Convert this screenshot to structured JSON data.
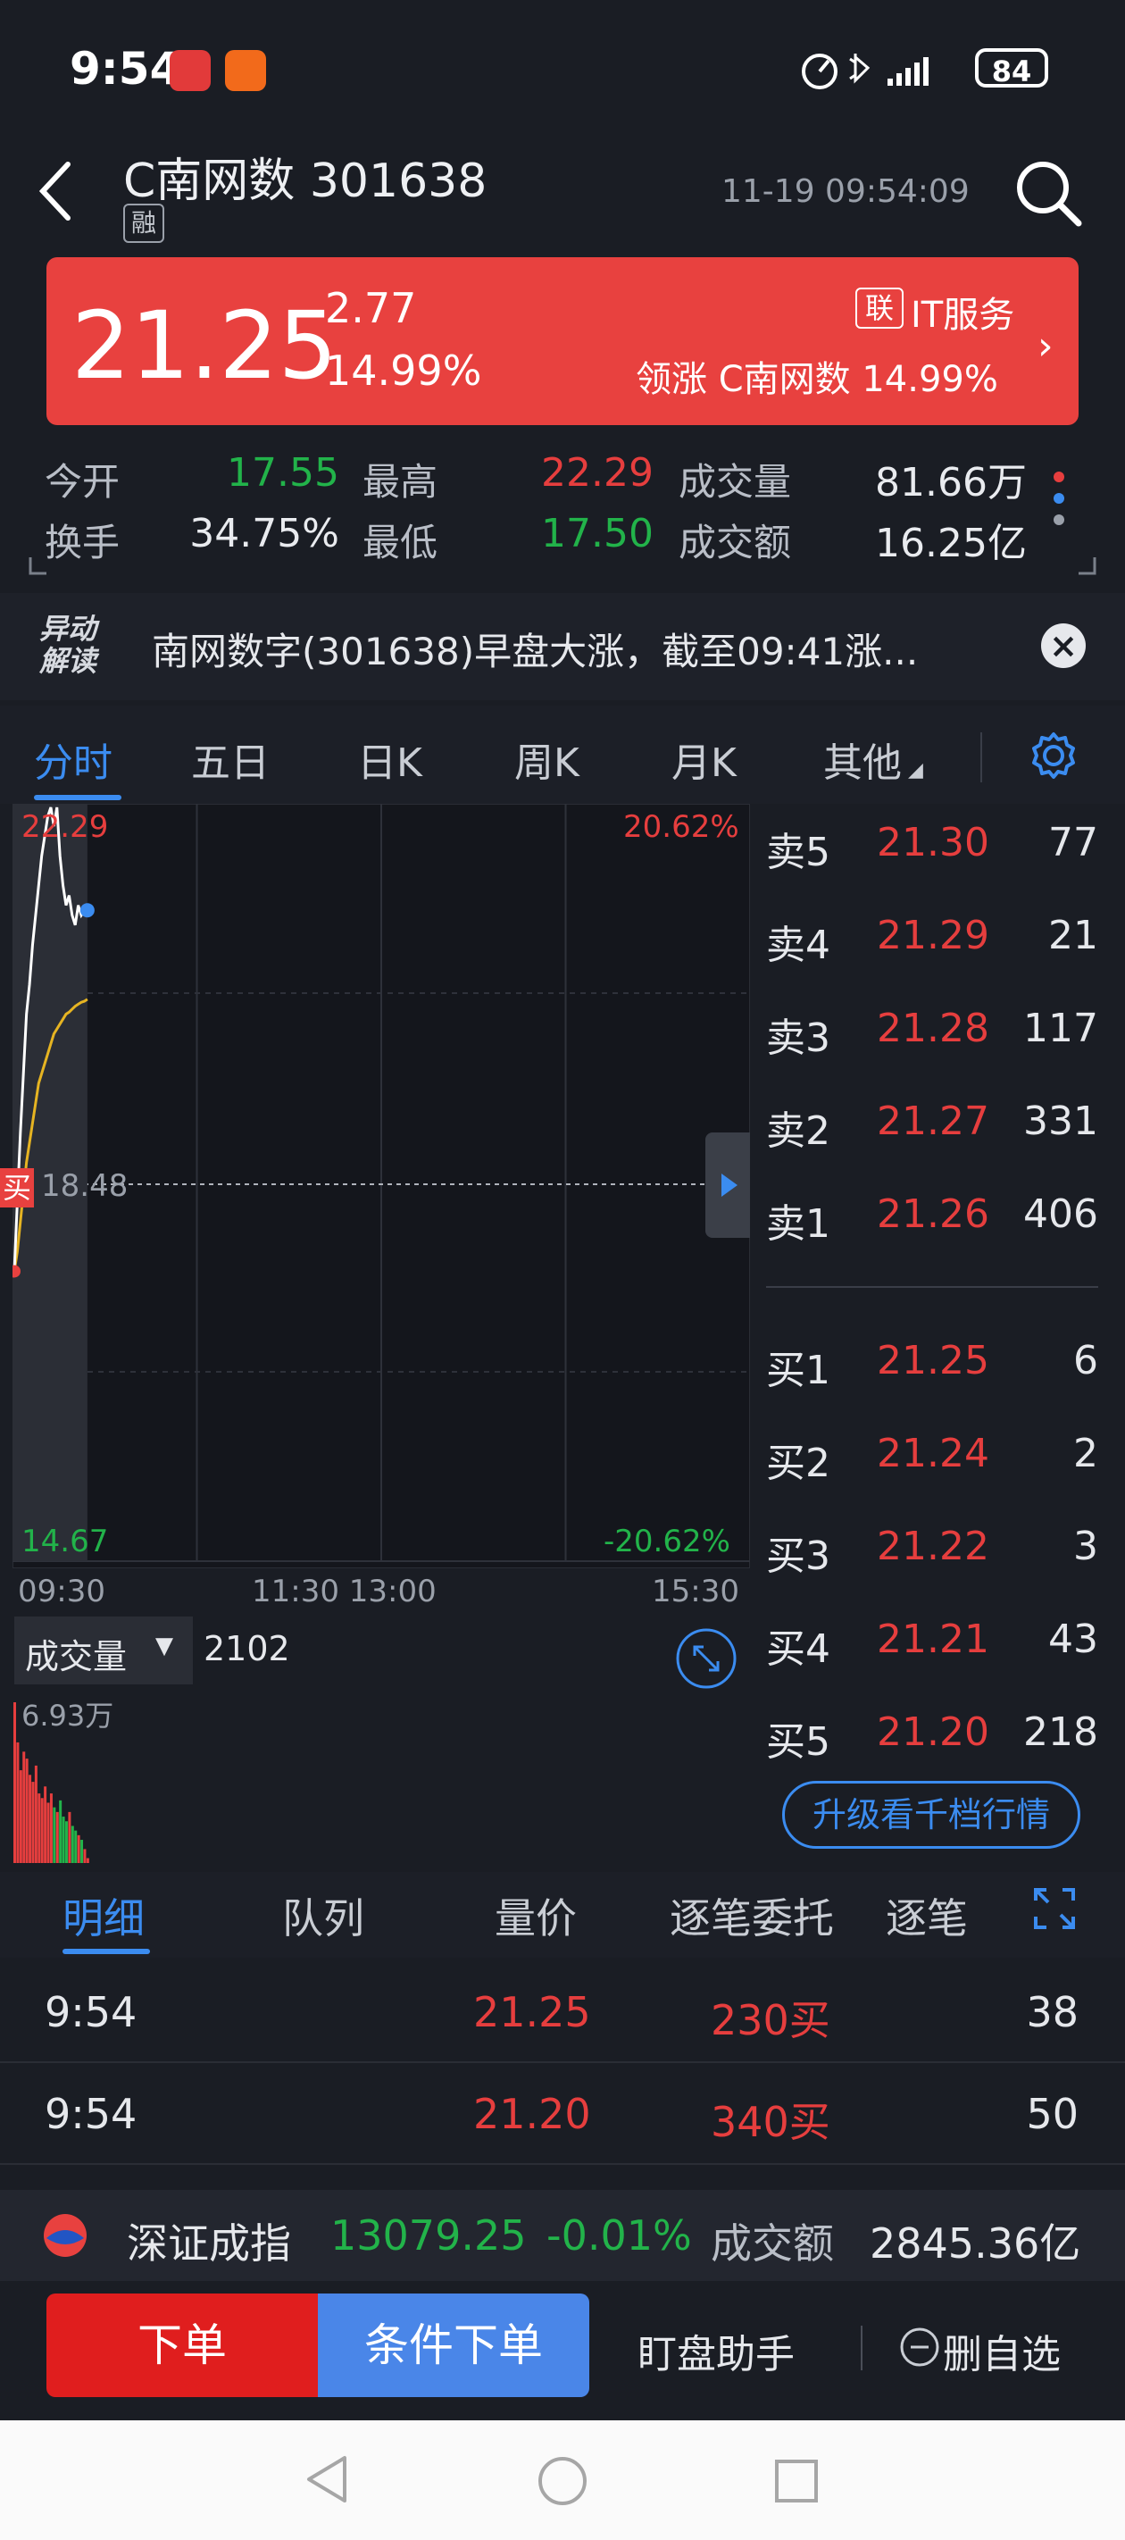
{
  "status": {
    "time": "9:54",
    "battery": "84"
  },
  "header": {
    "title": "C南网数 301638",
    "margin_tag": "融",
    "datetime": "11-19 09:54:09"
  },
  "quote": {
    "price": "21.25",
    "change": "2.77",
    "change_pct": "14.99%",
    "sector_tag": "联",
    "sector": "IT服务",
    "leader": "领涨 C南网数 14.99%"
  },
  "stats": {
    "open_label": "今开",
    "open": "17.55",
    "high_label": "最高",
    "high": "22.29",
    "vol_label": "成交量",
    "vol": "81.66万",
    "turnover_label": "换手",
    "turnover": "34.75%",
    "low_label": "最低",
    "low": "17.50",
    "amount_label": "成交额",
    "amount": "16.25亿"
  },
  "news": {
    "icon_text": "异动解读",
    "text": "南网数字(301638)早盘大涨，截至09:41涨..."
  },
  "tabs": [
    "分时",
    "五日",
    "日K",
    "周K",
    "月K",
    "其他"
  ],
  "chart": {
    "top_price": "22.29",
    "top_pct": "20.62%",
    "mid_price": "18.48",
    "bottom_price": "14.67",
    "bottom_pct": "-20.62%",
    "buy_marker": "买",
    "time_start": "09:30",
    "time_mid": "11:30 13:00",
    "time_end": "15:30",
    "vol_label": "成交量",
    "vol_value": "2102",
    "vol_max": "6.93万"
  },
  "chart_data": {
    "type": "line",
    "title": "",
    "x": [
      "09:30",
      "09:31",
      "09:32",
      "09:33",
      "09:34",
      "09:35",
      "09:36",
      "09:37",
      "09:38",
      "09:39",
      "09:40",
      "09:41",
      "09:42",
      "09:43",
      "09:44",
      "09:45",
      "09:46",
      "09:47",
      "09:48",
      "09:49",
      "09:50",
      "09:51",
      "09:52",
      "09:53",
      "09:54"
    ],
    "series": [
      {
        "values": [
          17.6,
          18.3,
          19.0,
          19.6,
          20.2,
          20.5,
          20.9,
          21.2,
          21.5,
          21.8,
          22.0,
          22.2,
          22.29,
          22.1,
          22.29,
          21.8,
          21.5,
          21.3,
          21.4,
          21.2,
          21.1,
          21.3,
          21.2,
          21.25,
          21.25
        ]
      },
      {
        "values": [
          17.6,
          17.8,
          18.1,
          18.4,
          18.7,
          18.9,
          19.1,
          19.3,
          19.5,
          19.6,
          19.7,
          19.8,
          19.9,
          20.0,
          20.05,
          20.1,
          20.15,
          20.2,
          20.22,
          20.25,
          20.28,
          20.3,
          20.32,
          20.33,
          20.35
        ]
      }
    ],
    "volume": [
      69300,
      52000,
      40000,
      48000,
      45000,
      38000,
      35000,
      42000,
      30000,
      28000,
      33000,
      26000,
      30000,
      24000,
      22000,
      27000,
      20000,
      18000,
      22000,
      16000,
      14000,
      12000,
      10000,
      6000,
      2102
    ],
    "ylim": [
      14.67,
      22.29
    ],
    "xlabel": "",
    "ylabel": ""
  },
  "orderbook": {
    "asks": [
      {
        "label": "卖5",
        "price": "21.30",
        "qty": "77"
      },
      {
        "label": "卖4",
        "price": "21.29",
        "qty": "21"
      },
      {
        "label": "卖3",
        "price": "21.28",
        "qty": "117"
      },
      {
        "label": "卖2",
        "price": "21.27",
        "qty": "331"
      },
      {
        "label": "卖1",
        "price": "21.26",
        "qty": "406"
      }
    ],
    "bids": [
      {
        "label": "买1",
        "price": "21.25",
        "qty": "6"
      },
      {
        "label": "买2",
        "price": "21.24",
        "qty": "2"
      },
      {
        "label": "买3",
        "price": "21.22",
        "qty": "3"
      },
      {
        "label": "买4",
        "price": "21.21",
        "qty": "43"
      },
      {
        "label": "买5",
        "price": "21.20",
        "qty": "218"
      }
    ],
    "upgrade_label": "升级看千档行情"
  },
  "detail_tabs": [
    "明细",
    "队列",
    "量价",
    "逐笔委托",
    "逐笔"
  ],
  "trades": [
    {
      "time": "9:54",
      "price": "21.25",
      "vol": "230买",
      "count": "38"
    },
    {
      "time": "9:54",
      "price": "21.20",
      "vol": "340买",
      "count": "50"
    }
  ],
  "index": {
    "name": "深证成指",
    "value": "13079.25",
    "change": "-0.01%",
    "amount_label": "成交额",
    "amount": "2845.36亿"
  },
  "actions": {
    "order": "下单",
    "conditional": "条件下单",
    "assistant": "盯盘助手",
    "remove_watch": "删自选"
  }
}
